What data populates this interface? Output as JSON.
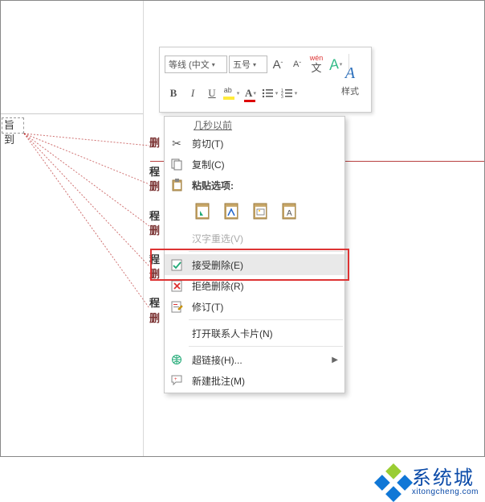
{
  "selected_text": "旨到",
  "mini_toolbar": {
    "font_name": "等线 (中文",
    "font_size": "五号",
    "grow_font_icon": "A",
    "shrink_font_icon": "A",
    "phonetic_icon": "文",
    "format_painter_icon": "A",
    "styles_label": "样式",
    "bold": "B",
    "italic": "I",
    "underline": "U",
    "font_color_letter": "A"
  },
  "context_menu": {
    "top_hint": "几秒以前",
    "cut": "剪切(T)",
    "copy": "复制(C)",
    "paste_header": "粘贴选项:",
    "reconvert": "汉字重选(V)",
    "accept_delete": "接受删除(E)",
    "reject_delete": "拒绝删除(R)",
    "track_changes": "修订(T)",
    "open_contact": "打开联系人卡片(N)",
    "hyperlink": "超链接(H)...",
    "new_comment": "新建批注(M)"
  },
  "revision_labels": {
    "g1a": "删",
    "g2a": "程",
    "g2b": "删",
    "g3a": "程",
    "g3b": "删",
    "g4a": "程",
    "g4b": "删",
    "g5a": "程",
    "g5b": "删"
  },
  "watermark": {
    "title": "系统城",
    "url": "xitongcheng.com"
  }
}
